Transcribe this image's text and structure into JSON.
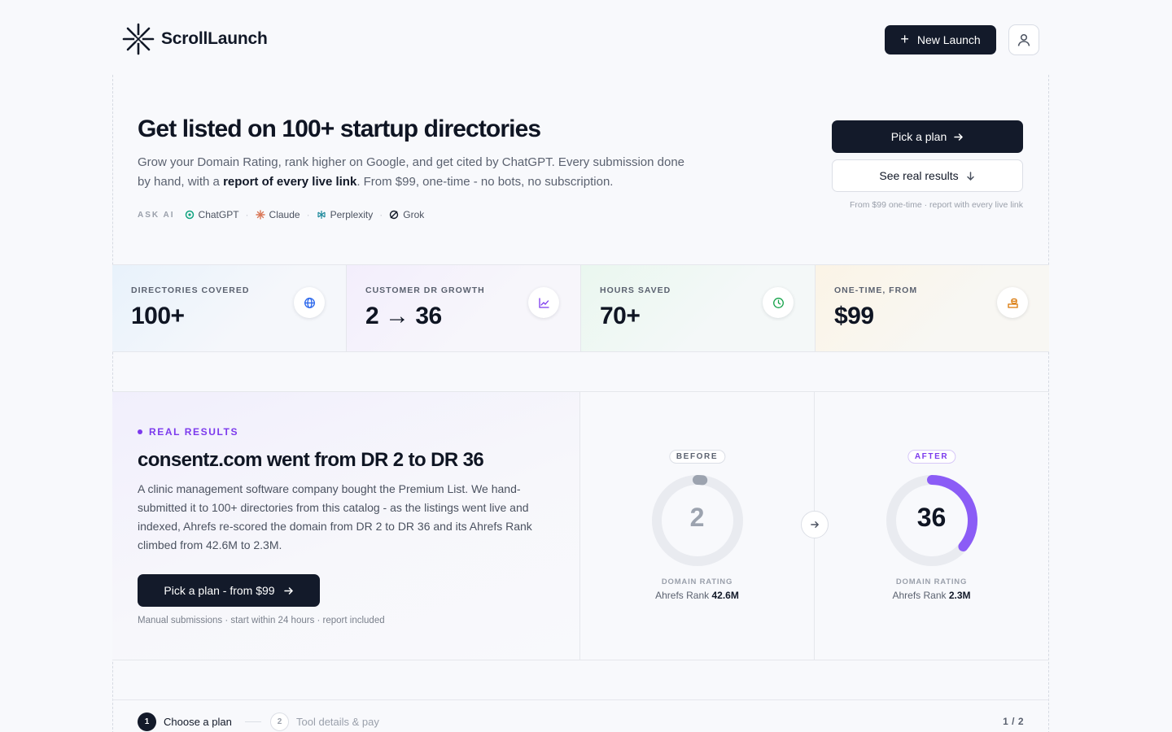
{
  "header": {
    "brand": "ScrollLaunch",
    "new_launch_label": "New Launch"
  },
  "hero": {
    "title": "Get listed on 100+ startup directories",
    "sub_part1": "Grow your Domain Rating, rank higher on Google, and get cited by ChatGPT. Every submission done by hand, with a ",
    "sub_bold": "report of every live link",
    "sub_part2": ". From $99, one-time - no bots, no subscription.",
    "ask_ai_label": "ASK AI",
    "ai_tools": [
      "ChatGPT",
      "Claude",
      "Perplexity",
      "Grok"
    ],
    "pick_plan_label": "Pick a plan",
    "see_results_label": "See real results",
    "cta_note": "From $99 one-time · report with every live link"
  },
  "stats": [
    {
      "label": "DIRECTORIES COVERED",
      "value": "100+",
      "icon": "globe-icon",
      "icon_color": "#2563eb"
    },
    {
      "label": "CUSTOMER DR GROWTH",
      "value": "2 → 36",
      "icon": "chart-icon",
      "icon_color": "#7c3aed"
    },
    {
      "label": "HOURS SAVED",
      "value": "70+",
      "icon": "clock-icon",
      "icon_color": "#16a34a"
    },
    {
      "label": "ONE-TIME, FROM",
      "value": "$99",
      "icon": "coins-icon",
      "icon_color": "#d97706"
    }
  ],
  "results": {
    "tag": "REAL RESULTS",
    "title": "consentz.com went from DR 2 to DR 36",
    "body": "A clinic management software company bought the Premium List. We hand-submitted it to 100+ directories from this catalog - as the listings went live and indexed, Ahrefs re-scored the domain from DR 2 to DR 36 and its Ahrefs Rank climbed from 42.6M to 2.3M.",
    "button_label": "Pick a plan - from $99",
    "note": "Manual submissions · start within 24 hours · report included",
    "before": {
      "pill": "BEFORE",
      "value": "2",
      "fraction": 0.02,
      "metric": "DOMAIN RATING",
      "rank_label": "Ahrefs Rank",
      "rank_value": "42.6M"
    },
    "after": {
      "pill": "AFTER",
      "value": "36",
      "fraction": 0.36,
      "metric": "DOMAIN RATING",
      "rank_label": "Ahrefs Rank",
      "rank_value": "2.3M"
    }
  },
  "steps": {
    "step1_num": "1",
    "step1_label": "Choose a plan",
    "step2_num": "2",
    "step2_label": "Tool details & pay",
    "count": "1 / 2"
  },
  "colors": {
    "accent": "#7c3aed",
    "dark": "#131a2a"
  }
}
